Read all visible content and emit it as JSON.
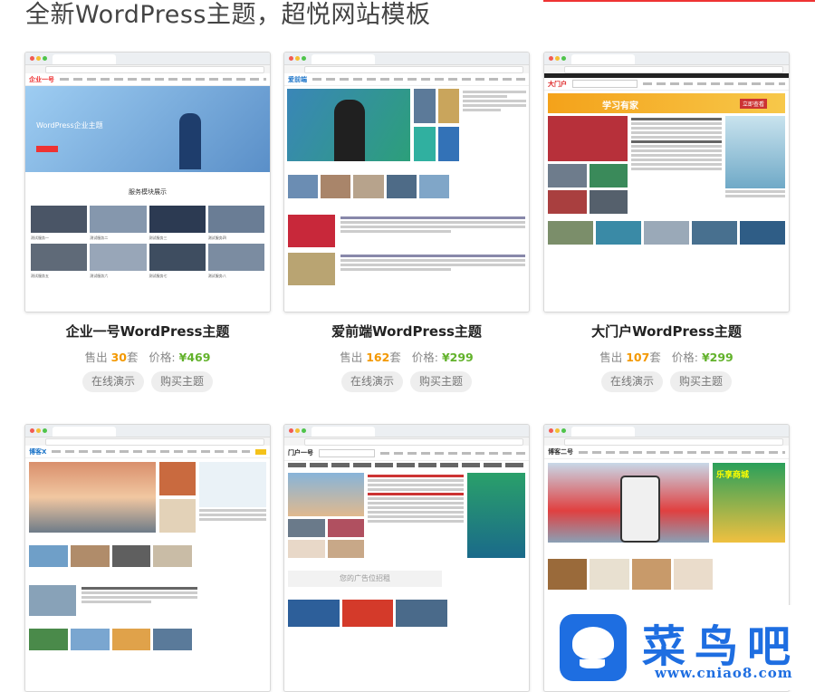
{
  "page": {
    "title": "全新WordPress主题，超悦网站模板"
  },
  "labels": {
    "sold_prefix": "售出",
    "sold_suffix": "套",
    "price_prefix": "价格:"
  },
  "themes": [
    {
      "name": "企业一号WordPress主题",
      "sold": "30",
      "price": "¥469",
      "demo_label": "在线演示",
      "buy_label": "购买主题",
      "preview": {
        "logo": "企业一号",
        "hero_text": "WordPress企业主题",
        "section_title": "服务模块展示",
        "items": [
          "测试服务一",
          "测试服务二",
          "测试服务三",
          "测试服务四",
          "测试服务五",
          "测试服务六",
          "测试服务七",
          "测试服务八"
        ]
      }
    },
    {
      "name": "爱前端WordPress主题",
      "sold": "162",
      "price": "¥299",
      "demo_label": "在线演示",
      "buy_label": "购买主题",
      "preview": {
        "logo": "爱前端"
      }
    },
    {
      "name": "大门户WordPress主题",
      "sold": "107",
      "price": "¥299",
      "demo_label": "在线演示",
      "buy_label": "购买主题",
      "preview": {
        "logo": "大门户",
        "banner_text": "学习有家",
        "banner_cta": "立即查看"
      }
    },
    {
      "preview": {
        "logo": "博客X"
      }
    },
    {
      "preview": {
        "logo": "门户一号",
        "ad_text": "您的广告位招租"
      }
    },
    {
      "preview": {
        "logo": "博客二号",
        "side_text": "乐享商城"
      }
    }
  ],
  "watermark": {
    "name": "菜鸟吧",
    "url": "www.cniao8.com"
  },
  "colors": {
    "accent_red": "#ee3333",
    "sold": "#f39800",
    "price": "#62b22b",
    "watermark_blue": "#1e6ee1"
  }
}
